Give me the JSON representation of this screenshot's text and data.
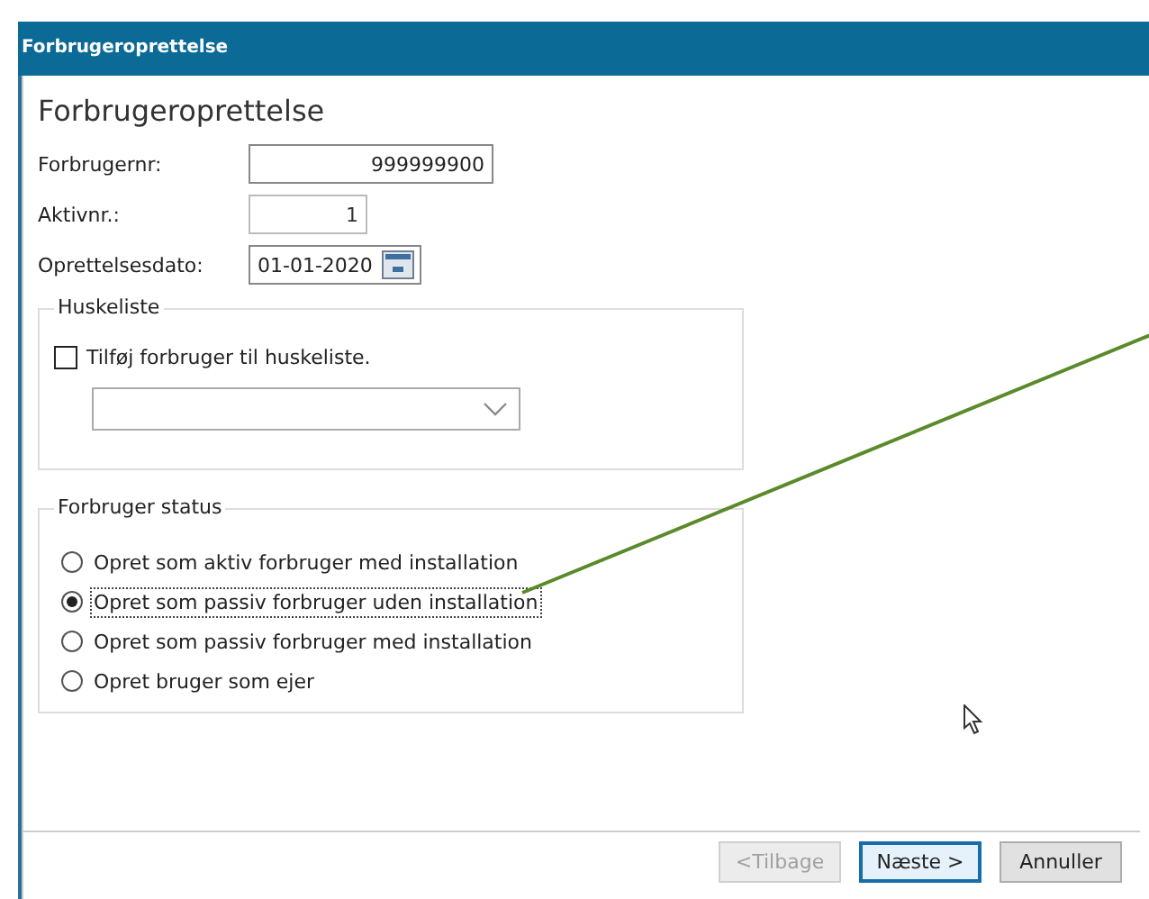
{
  "window": {
    "title": "Forbrugeroprettelse"
  },
  "heading": "Forbrugeroprettelse",
  "fields": [
    {
      "label": "Forbrugernr:",
      "value": "999999900",
      "kind": "number",
      "disabled": false
    },
    {
      "label": "Aktivnr.:",
      "value": "1",
      "kind": "number",
      "disabled": true
    },
    {
      "label": "Oprettelsesdato:",
      "value": "01-01-2020",
      "kind": "date",
      "disabled": false
    }
  ],
  "huskeliste": {
    "title": "Huskeliste",
    "checkbox": {
      "label": "Tilføj forbruger til huskeliste.",
      "checked": false
    }
  },
  "status": {
    "title": "Forbruger status",
    "options": [
      {
        "label": "Opret som aktiv forbruger med installation",
        "selected": false
      },
      {
        "label": "Opret som passiv forbruger uden installation",
        "selected": true
      },
      {
        "label": "Opret som passiv forbruger med installation",
        "selected": false
      },
      {
        "label": "Opret bruger som ejer",
        "selected": false
      }
    ]
  },
  "buttons": [
    {
      "label": "<Tilbage",
      "disabled": true,
      "focused": false
    },
    {
      "label": "Næste >",
      "disabled": false,
      "focused": true
    },
    {
      "label": "Annuller",
      "disabled": false,
      "focused": false
    }
  ]
}
